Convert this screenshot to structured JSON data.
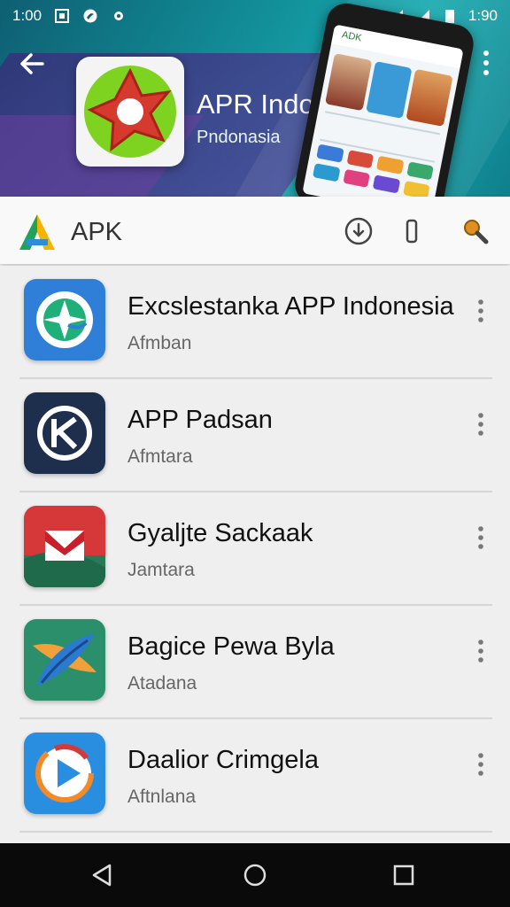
{
  "status_bar": {
    "time_left": "1:00",
    "time_right": "1:90",
    "icons_left": [
      "screenshot-icon",
      "app-icon",
      "dot-icon"
    ],
    "icons_right": [
      "wifi-icon",
      "settings-icon",
      "signal-icon",
      "signal-icon",
      "battery-icon"
    ]
  },
  "header": {
    "app_title": "APR Indom",
    "app_subtitle": "Pndonasia",
    "phone_mock_label": "ADK"
  },
  "toolbar": {
    "label": "APK",
    "buttons": [
      "download-icon",
      "phone-icon",
      "search-icon"
    ]
  },
  "apps": [
    {
      "title": "Excslestanka APP Indonesia",
      "subtitle": "Afmban",
      "icon": "compass-icon",
      "color": "#2f7fd8"
    },
    {
      "title": "APP Padsan",
      "subtitle": "Afmtara",
      "icon": "k-logo-icon",
      "color": "#1e2f4e"
    },
    {
      "title": "Gyaljte Sackaak",
      "subtitle": "Jamtara",
      "icon": "mail-icon",
      "color": "#d6383a"
    },
    {
      "title": "Bagice Pewa Byla",
      "subtitle": "Atadana",
      "icon": "feather-icon",
      "color": "#2a8f6a"
    },
    {
      "title": "Daalior Crimgela",
      "subtitle": "Aftnlana",
      "icon": "play-icon",
      "color": "#2a8ee0"
    }
  ],
  "colors": {
    "header_teal": "#12909a",
    "accent_purple": "#5a3a9a",
    "list_bg": "#efefef",
    "nav_bg": "#0a0a0a"
  }
}
